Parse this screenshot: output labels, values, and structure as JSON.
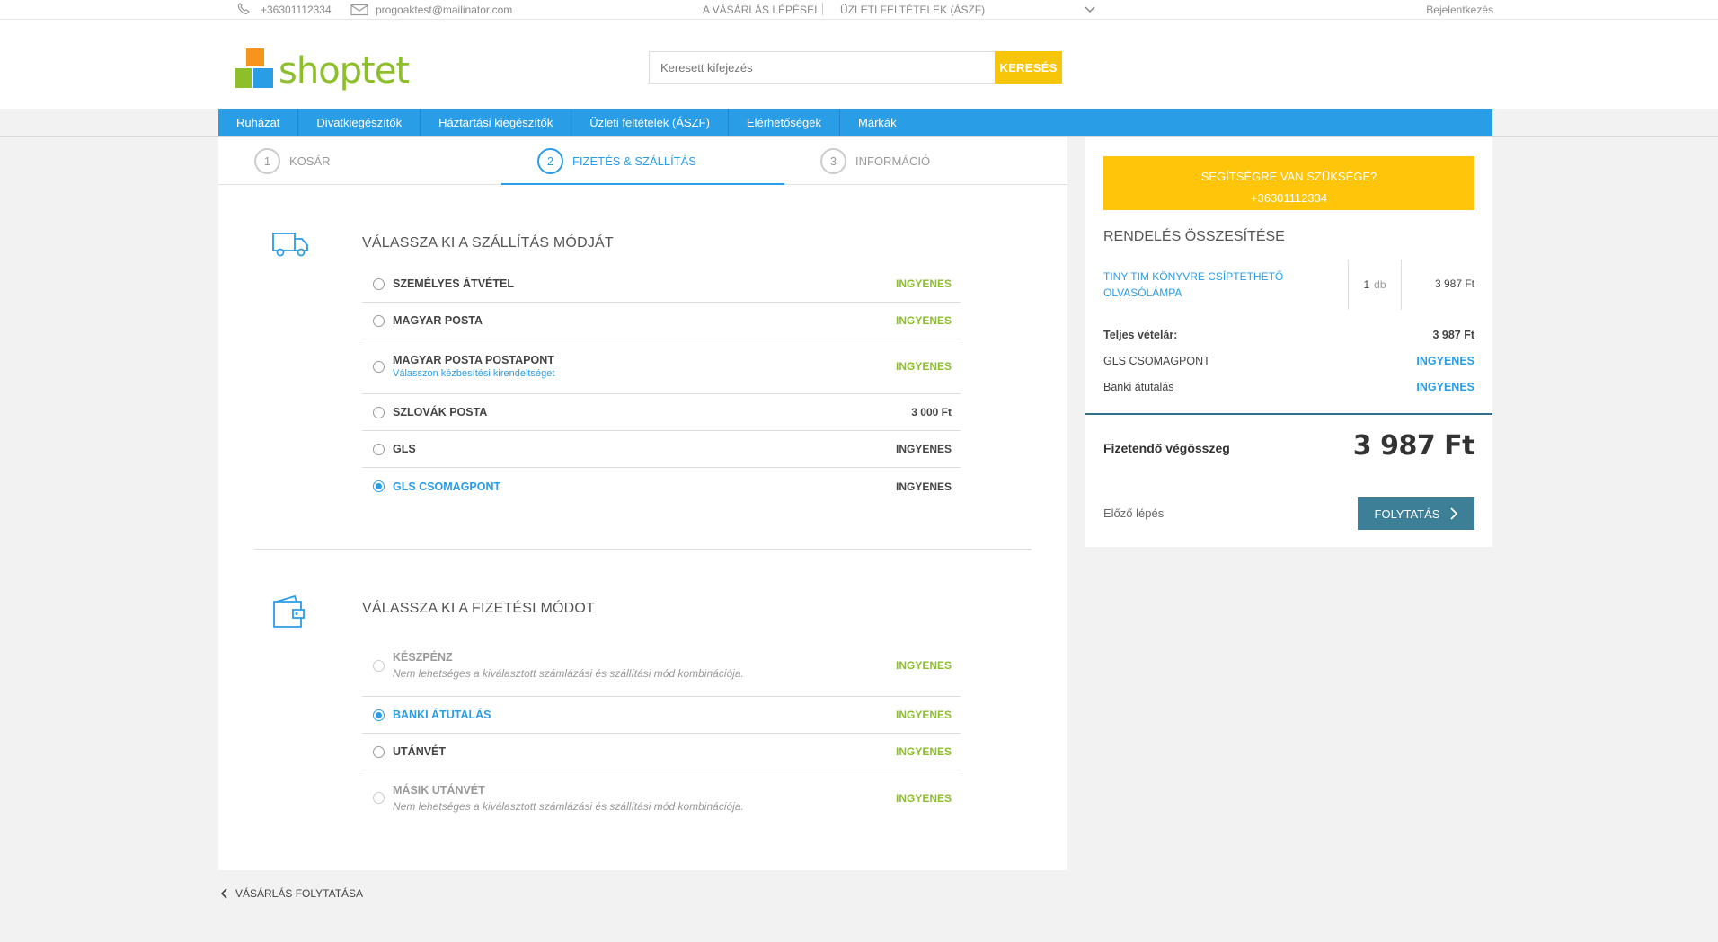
{
  "topbar": {
    "phone": "+36301112334",
    "email": "progoaktest@mailinator.com",
    "link1": "A VÁSÁRLÁS LÉPÉSEI",
    "link2": "ÜZLETI FELTÉTELEK (ÁSZF)",
    "login": "Bejelentkezés"
  },
  "header": {
    "logo_text": "shoptet",
    "search_placeholder": "Keresett kifejezés",
    "search_button": "KERESÉS"
  },
  "nav": {
    "items": [
      {
        "label": "Ruházat"
      },
      {
        "label": "Divatkiegészítők"
      },
      {
        "label": "Háztartási kiegészítők"
      },
      {
        "label": "Üzleti feltételek (ÁSZF)"
      },
      {
        "label": "Elérhetőségek"
      },
      {
        "label": "Márkák"
      }
    ]
  },
  "steps": [
    {
      "num": "1",
      "label": "KOSÁR"
    },
    {
      "num": "2",
      "label": "FIZETÉS & SZÁLLÍTÁS"
    },
    {
      "num": "3",
      "label": "INFORMÁCIÓ"
    }
  ],
  "shipping": {
    "title": "VÁLASSZA KI A SZÁLLÍTÁS MÓDJÁT",
    "options": [
      {
        "name": "SZEMÉLYES ÁTVÉTEL",
        "price": "INGYENES"
      },
      {
        "name": "MAGYAR POSTA",
        "price": "INGYENES"
      },
      {
        "name": "MAGYAR POSTA POSTAPONT",
        "sub": "Válasszon kézbesítési kirendeltséget",
        "price": "INGYENES"
      },
      {
        "name": "SZLOVÁK POSTA",
        "price": "3 000 Ft"
      },
      {
        "name": "GLS",
        "price": "INGYENES"
      },
      {
        "name": "GLS CSOMAGPONT",
        "price": "INGYENES"
      }
    ]
  },
  "payment": {
    "title": "VÁLASSZA KI A FIZETÉSI MÓDOT",
    "options": [
      {
        "name": "KÉSZPÉNZ",
        "note": "Nem lehetséges a kiválasztott számlázási és szállítási mód kombinációja.",
        "price": "INGYENES"
      },
      {
        "name": "BANKI ÁTUTALÁS",
        "price": "INGYENES"
      },
      {
        "name": "UTÁNVÉT",
        "price": "INGYENES"
      },
      {
        "name": "MÁSIK UTÁNVÉT",
        "note": "Nem lehetséges a kiválasztott számlázási és szállítási mód kombinációja.",
        "price": "INGYENES"
      }
    ]
  },
  "continue_shopping": "VÁSÁRLÁS FOLYTATÁSA",
  "sidebar": {
    "help_line1": "SEGÍTSÉGRE VAN SZÜKSÉGE?",
    "help_line2": "+36301112334",
    "title": "RENDELÉS ÖSSZESÍTÉSE",
    "item_name": "TINY TIM KÖNYVRE CSÍPTETHETŐ OLVASÓLÁMPA",
    "item_qty": "1",
    "item_unit": "db",
    "item_price": "3 987 Ft",
    "full_price_label": "Teljes vételár:",
    "full_price_value": "3 987 Ft",
    "shipping_label": "GLS CSOMAGPONT",
    "shipping_value": "INGYENES",
    "payment_label": "Banki átutalás",
    "payment_value": "INGYENES",
    "total_label": "Fizetendő végösszeg",
    "total_value": "3 987 Ft",
    "prev_step": "Előző lépés",
    "next_button": "FOLYTATÁS"
  },
  "colors": {
    "accent_blue": "#2a9de7",
    "yellow": "#ffc50a",
    "green_price": "#8cbf2a",
    "button_teal": "#3d7f96"
  }
}
